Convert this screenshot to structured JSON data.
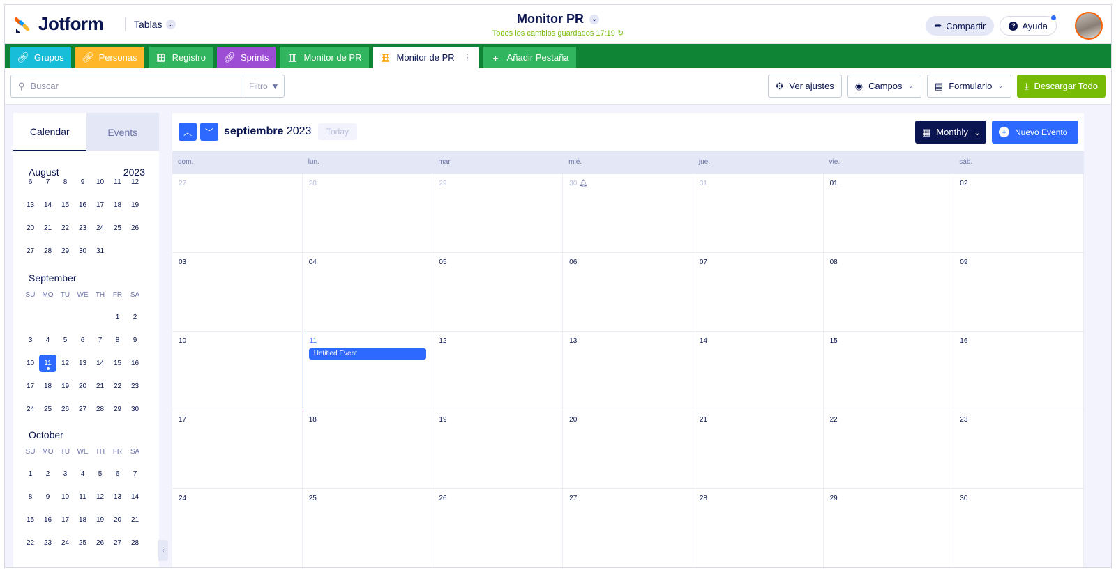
{
  "header": {
    "logo_text": "Jotform",
    "tablas_label": "Tablas",
    "title": "Monitor PR",
    "saved_status": "Todos los cambios guardados 17:19",
    "share_label": "Compartir",
    "help_label": "Ayuda"
  },
  "tabs": [
    {
      "label": "Grupos",
      "color": "#18bdd9",
      "icon": "link-icon"
    },
    {
      "label": "Personas",
      "color": "#ffb629",
      "icon": "link-icon"
    },
    {
      "label": "Registro",
      "color": "#32b55f",
      "icon": "table-icon"
    },
    {
      "label": "Sprints",
      "color": "#9c4dd3",
      "icon": "link-icon"
    },
    {
      "label": "Monitor de PR",
      "color": "#32b55f",
      "icon": "kanban-icon"
    },
    {
      "label": "Monitor de PR",
      "active": true,
      "icon": "calendar-icon"
    },
    {
      "label": "Añadir Pestaña",
      "icon": "plus-icon"
    }
  ],
  "toolbar": {
    "search_placeholder": "Buscar",
    "filter_label": "Filtro",
    "settings_label": "Ver ajustes",
    "fields_label": "Campos",
    "form_label": "Formulario",
    "download_label": "Descargar Todo"
  },
  "sidebar": {
    "tab_calendar": "Calendar",
    "tab_events": "Events",
    "august": {
      "name": "August",
      "year": "2023",
      "rows": [
        [
          "6",
          "7",
          "8",
          "9",
          "10",
          "11",
          "12"
        ],
        [
          "13",
          "14",
          "15",
          "16",
          "17",
          "18",
          "19"
        ],
        [
          "20",
          "21",
          "22",
          "23",
          "24",
          "25",
          "26"
        ],
        [
          "27",
          "28",
          "29",
          "30",
          "31",
          "",
          ""
        ]
      ]
    },
    "september": {
      "name": "September",
      "rows": [
        [
          "",
          "",
          "",
          "",
          "",
          "1",
          "2"
        ],
        [
          "3",
          "4",
          "5",
          "6",
          "7",
          "8",
          "9"
        ],
        [
          "10",
          "11",
          "12",
          "13",
          "14",
          "15",
          "16"
        ],
        [
          "17",
          "18",
          "19",
          "20",
          "21",
          "22",
          "23"
        ],
        [
          "24",
          "25",
          "26",
          "27",
          "28",
          "29",
          "30"
        ]
      ]
    },
    "october": {
      "name": "October",
      "rows": [
        [
          "1",
          "2",
          "3",
          "4",
          "5",
          "6",
          "7"
        ],
        [
          "8",
          "9",
          "10",
          "11",
          "12",
          "13",
          "14"
        ],
        [
          "15",
          "16",
          "17",
          "18",
          "19",
          "20",
          "21"
        ],
        [
          "22",
          "23",
          "24",
          "25",
          "26",
          "27",
          "28"
        ]
      ]
    },
    "dow": [
      "SU",
      "MO",
      "TU",
      "WE",
      "TH",
      "FR",
      "SA"
    ],
    "selected_day": "11"
  },
  "calendar": {
    "month": "septiembre",
    "year": "2023",
    "today_label": "Today",
    "view_label": "Monthly",
    "new_event_label": "Nuevo Evento",
    "dow": [
      "dom.",
      "lun.",
      "mar.",
      "mié.",
      "jue.",
      "vie.",
      "sáb."
    ],
    "weeks": [
      [
        "27",
        "28",
        "29",
        "30",
        "31",
        "01",
        "02"
      ],
      [
        "03",
        "04",
        "05",
        "06",
        "07",
        "08",
        "09"
      ],
      [
        "10",
        "11",
        "12",
        "13",
        "14",
        "15",
        "16"
      ],
      [
        "17",
        "18",
        "19",
        "20",
        "21",
        "22",
        "23"
      ],
      [
        "24",
        "25",
        "26",
        "27",
        "28",
        "29",
        "30"
      ]
    ],
    "dim_cells": 5,
    "event": {
      "title": "Untitled Event",
      "day": "11"
    }
  }
}
